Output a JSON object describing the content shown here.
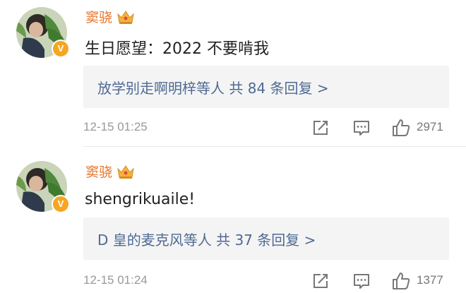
{
  "comments": [
    {
      "username": "窦骁",
      "avatar_icon": "avatar-photo",
      "verified_icon": "verified-v-icon",
      "badge_icon": "crown-icon",
      "verified_label": "V",
      "text": "生日愿望：2022 不要啃我",
      "replies_summary": "放学别走啊明梓等人  共 84 条回复 >",
      "timestamp": "12-15 01:25",
      "like_count": "2971"
    },
    {
      "username": "窦骁",
      "avatar_icon": "avatar-photo",
      "verified_icon": "verified-v-icon",
      "badge_icon": "crown-icon",
      "verified_label": "V",
      "text": "shengrikuaile!",
      "replies_summary": "D 皇的麦克风等人  共 37 条回复 >",
      "timestamp": "12-15 01:24",
      "like_count": "1377"
    }
  ],
  "colors": {
    "username": "#e8762b",
    "reply_link": "#4e6a94",
    "meta": "#999999",
    "reply_box_bg": "#f4f4f4",
    "verified_badge": "#f5a623"
  }
}
